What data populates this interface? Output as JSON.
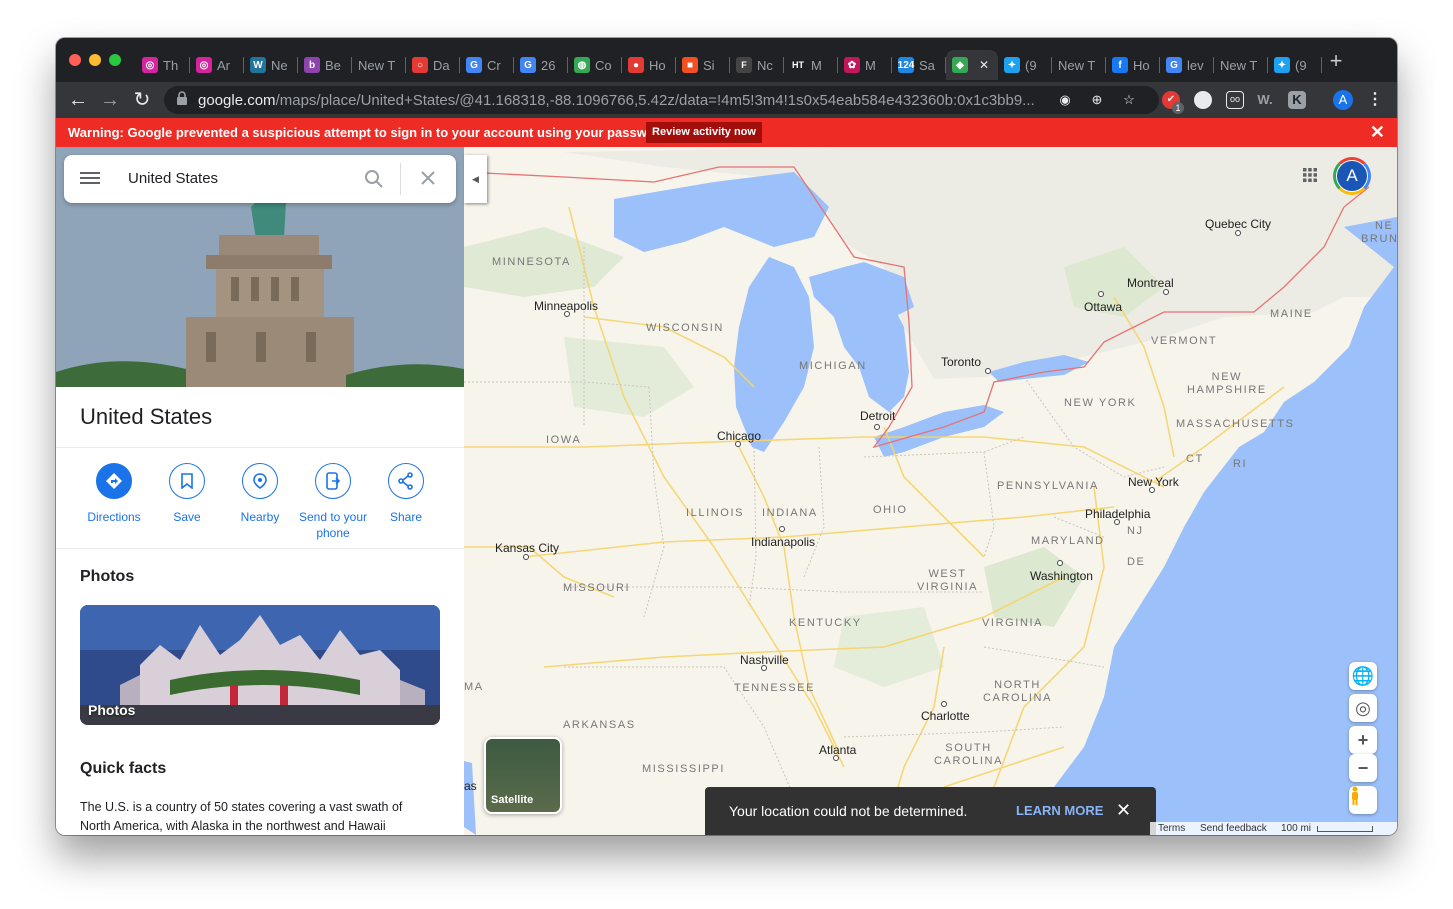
{
  "browser": {
    "tabs": [
      {
        "title": "Th",
        "icon": "instagram-icon",
        "color": "#d6249f"
      },
      {
        "title": "Ar",
        "icon": "instagram-icon",
        "color": "#d6249f"
      },
      {
        "title": "Ne",
        "icon": "wordpress-icon",
        "color": "#21759b"
      },
      {
        "title": "Be",
        "icon": "b-icon",
        "color": "#8e44ad"
      },
      {
        "title": "New T",
        "icon": "",
        "color": ""
      },
      {
        "title": "Da",
        "icon": "circle-icon",
        "color": "#e53935"
      },
      {
        "title": "Cr",
        "icon": "google-icon",
        "color": "#4285f4"
      },
      {
        "title": "26",
        "icon": "google-icon",
        "color": "#4285f4"
      },
      {
        "title": "Co",
        "icon": "globe-icon",
        "color": "#34a853"
      },
      {
        "title": "Ho",
        "icon": "tomato-icon",
        "color": "#e53935"
      },
      {
        "title": "Si",
        "icon": "microsoft-icon",
        "color": "#f25022"
      },
      {
        "title": "Nc",
        "icon": "f-icon",
        "color": "#444444"
      },
      {
        "title": "M",
        "icon": "ht-icon",
        "color": "#202124"
      },
      {
        "title": "M",
        "icon": "pattern-icon",
        "color": "#c2185b"
      },
      {
        "title": "Sa",
        "icon": "124-icon",
        "color": "#1e88e5"
      },
      {
        "title": "",
        "icon": "maps-icon",
        "color": "#34a853",
        "active": true
      },
      {
        "title": "(9",
        "icon": "twitter-icon",
        "color": "#1da1f2"
      },
      {
        "title": "New T",
        "icon": "",
        "color": ""
      },
      {
        "title": "Ho",
        "icon": "facebook-icon",
        "color": "#1877f2"
      },
      {
        "title": "lev",
        "icon": "google-icon",
        "color": "#4285f4"
      },
      {
        "title": "New T",
        "icon": "",
        "color": ""
      },
      {
        "title": "(9",
        "icon": "twitter-icon",
        "color": "#1da1f2"
      }
    ],
    "url_host": "google.com",
    "url_path": "/maps/place/United+States/@41.168318,-88.1096766,5.42z/data=!4m5!3m4!1s0x54eab584e432360b:0x1c3bb9...",
    "profile_initial": "A",
    "extension_badge": "1"
  },
  "warning": {
    "text": "Warning: Google prevented a suspicious attempt to sign in to your account using your password.",
    "button": "Review activity now"
  },
  "search": {
    "value": "United States"
  },
  "place": {
    "title": "United States",
    "actions": [
      {
        "label": "Directions",
        "icon": "directions-icon"
      },
      {
        "label": "Save",
        "icon": "bookmark-icon"
      },
      {
        "label": "Nearby",
        "icon": "nearby-icon"
      },
      {
        "label": "Send to your phone",
        "icon": "send-to-phone-icon"
      },
      {
        "label": "Share",
        "icon": "share-icon"
      }
    ],
    "photos_title": "Photos",
    "photos_label": "Photos",
    "facts_title": "Quick facts",
    "facts_text": "The U.S. is a country of 50 states covering a vast swath of North America, with Alaska in the northwest and Hawaii"
  },
  "map": {
    "cities": [
      "Quebec City",
      "Montreal",
      "Ottawa",
      "Minneapolis",
      "Toronto",
      "Detroit",
      "Chicago",
      "New York",
      "Philadelphia",
      "Indianapolis",
      "Kansas City",
      "Washington",
      "Nashville",
      "Charlotte",
      "Atlanta"
    ],
    "states": [
      "MINNESOTA",
      "WISCONSIN",
      "MICHIGAN",
      "IOWA",
      "ILLINOIS",
      "INDIANA",
      "OHIO",
      "PENNSYLVANIA",
      "NEW YORK",
      "VERMONT",
      "NEW HAMPSHIRE",
      "MAINE",
      "MASSACHUSETTS",
      "CT",
      "RI",
      "NJ",
      "MARYLAND",
      "DE",
      "WEST VIRGINIA",
      "VIRGINIA",
      "KENTUCKY",
      "TENNESSEE",
      "MISSOURI",
      "ARKANSAS",
      "MISSISSIPPI",
      "NORTH CAROLINA",
      "SOUTH CAROLINA",
      "NE BRUNS",
      "MA",
      "as"
    ],
    "satellite_label": "Satellite",
    "footer": {
      "terms": "Terms",
      "feedback": "Send feedback",
      "scale": "100 mi"
    }
  },
  "snackbar": {
    "text": "Your location could not be determined.",
    "action": "LEARN MORE"
  }
}
